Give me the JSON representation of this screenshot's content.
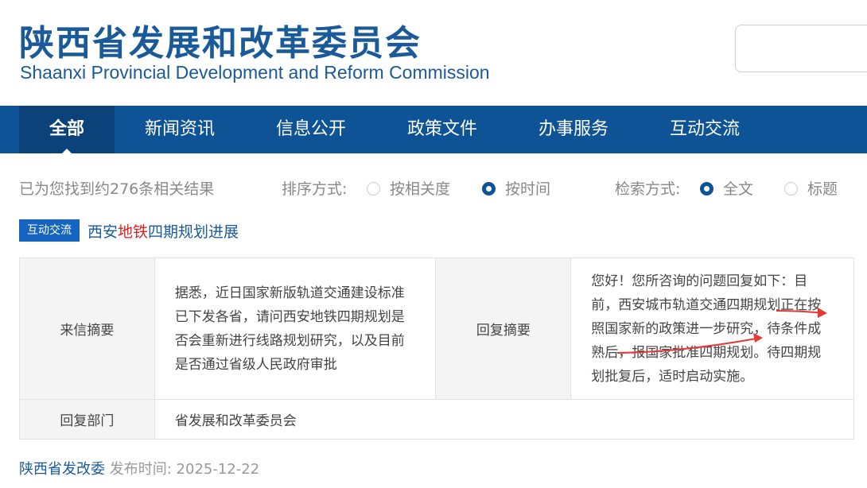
{
  "header": {
    "title_cn": "陕西省发展和改革委员会",
    "title_en": "Shaanxi Provincial Development and Reform Commission",
    "search_value": ""
  },
  "nav": {
    "items": [
      {
        "label": "全部",
        "active": true
      },
      {
        "label": "新闻资讯"
      },
      {
        "label": "信息公开"
      },
      {
        "label": "政策文件"
      },
      {
        "label": "办事服务"
      },
      {
        "label": "互动交流"
      }
    ]
  },
  "results": {
    "count_text": "已为您找到约276条相关结果",
    "sort_label": "排序方式:",
    "sort_options": [
      {
        "label": "按相关度",
        "selected": false
      },
      {
        "label": "按时间",
        "selected": true
      }
    ],
    "search_mode_label": "检索方式:",
    "search_mode_options": [
      {
        "label": "全文",
        "selected": true
      },
      {
        "label": "标题",
        "selected": false
      }
    ]
  },
  "item": {
    "badge": "互动交流",
    "title_before": "西安",
    "title_highlight": "地铁",
    "title_after": "四期规划进展",
    "letter_label": "来信摘要",
    "letter_text": "据悉，近日国家新版轨道交通建设标准已下发各省，请问西安地铁四期规划是否会重新进行线路规划研究，以及目前是否通过省级人民政府审批",
    "reply_label": "回复摘要",
    "reply_text": "您好！您所咨询的问题回复如下：目前，西安城市轨道交通四期规划正在按照国家新的政策进一步研究，待条件成熟后，报国家批准四期规划。待四期规划批复后，适时启动实施。",
    "dept_label": "回复部门",
    "dept_value": "省发展和改革委员会",
    "publisher": "陕西省发改委",
    "pub_label": "发布时间:",
    "pub_date": "2025-12-22"
  },
  "colors": {
    "brand": "#1a5a98",
    "nav_bg": "#0d5395",
    "nav_active": "#0a4279",
    "highlight": "#e02020",
    "annotation_arrow": "#e53935"
  }
}
